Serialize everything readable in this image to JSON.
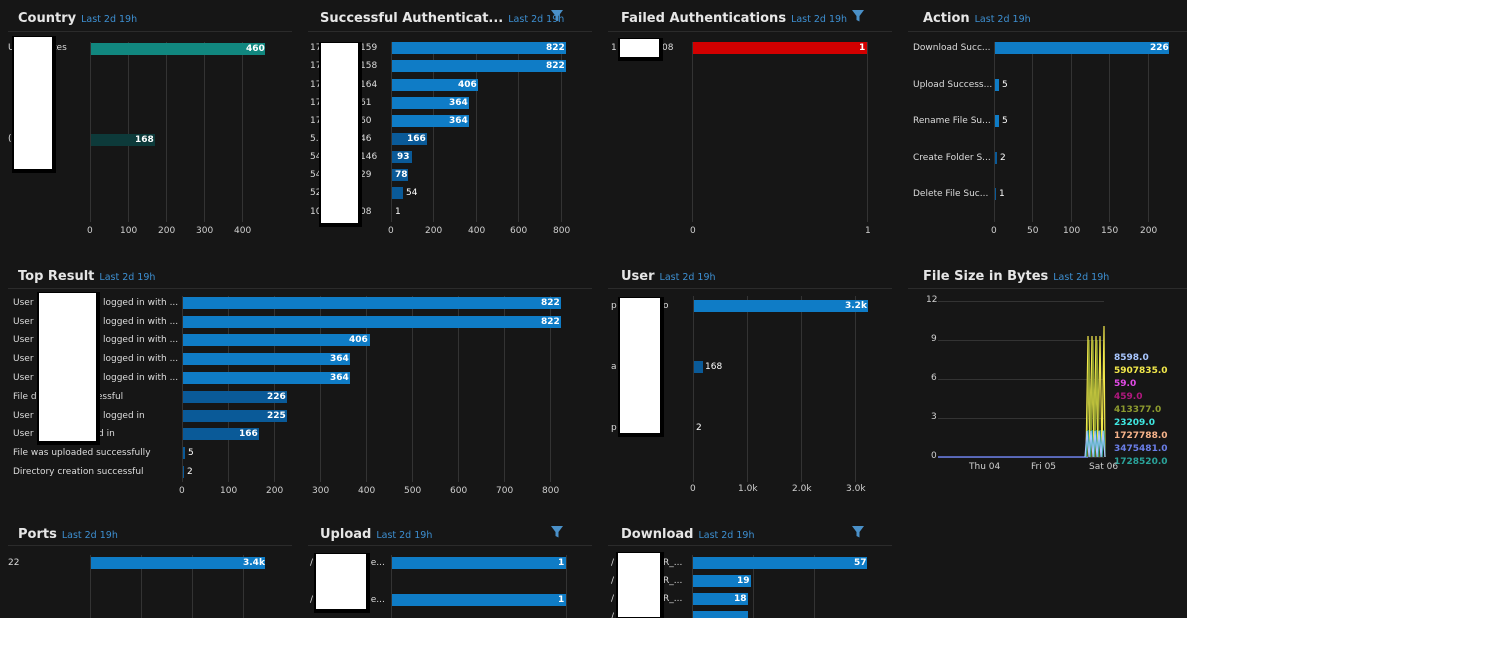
{
  "colors": {
    "bar_primary": "#0f7cc6",
    "bar_dark": "#0a5a98",
    "bar_teal": "#11877f",
    "bar_dark_teal": "#0d3a3a",
    "bar_red": "#d10000",
    "filter_icon": "#4a90c8"
  },
  "panels": {
    "country": {
      "title": "Country",
      "range": "Last 2d 19h",
      "labels": [
        "U",
        "tes",
        "("
      ],
      "values": [
        "460",
        "168"
      ],
      "ticks": [
        "0",
        "100",
        "200",
        "300",
        "400"
      ]
    },
    "success_auth": {
      "title": "Successful Authenticat...",
      "range": "Last 2d 19h",
      "filter_icon": "filter-icon",
      "label_prefix": [
        "17",
        "17",
        "17",
        "17",
        "17",
        "5.",
        "54",
        "54",
        "52",
        "10"
      ],
      "label_suffix": [
        "159",
        "158",
        "164",
        "61",
        "60",
        "46",
        "146",
        "29",
        "",
        "08"
      ],
      "values": [
        "822",
        "822",
        "406",
        "364",
        "364",
        "166",
        "93",
        "78",
        "54",
        "1"
      ],
      "ticks": [
        "0",
        "200",
        "400",
        "600",
        "800"
      ]
    },
    "failed_auth": {
      "title": "Failed Authentications",
      "range": "Last 2d 19h",
      "filter_icon": "filter-icon",
      "label_prefix": "1",
      "label_suffix": "08",
      "value": "1",
      "ticks": [
        "0",
        "1"
      ]
    },
    "action": {
      "title": "Action",
      "range": "Last 2d 19h",
      "labels": [
        "Download Succ...",
        "Upload Success...",
        "Rename File Su...",
        "Create Folder S...",
        "Delete File Suc..."
      ],
      "values": [
        "226",
        "5",
        "5",
        "2",
        "1"
      ],
      "ticks": [
        "0",
        "50",
        "100",
        "150",
        "200"
      ]
    },
    "top_result": {
      "title": "Top Result",
      "range": "Last 2d 19h",
      "label_left": [
        "User",
        "User",
        "User",
        "User",
        "User",
        "File d",
        "User",
        "User",
        "File was uploaded successfully",
        "Directory creation successful"
      ],
      "label_right": [
        "logged in with ...",
        "logged in with ...",
        "logged in with ...",
        "logged in with ...",
        "logged in with ...",
        "ccessful",
        "logged in",
        "d in",
        "",
        ""
      ],
      "values": [
        "822",
        "822",
        "406",
        "364",
        "364",
        "226",
        "225",
        "166",
        "5",
        "2"
      ],
      "ticks": [
        "0",
        "100",
        "200",
        "300",
        "400",
        "500",
        "600",
        "700",
        "800"
      ]
    },
    "user": {
      "title": "User",
      "range": "Last 2d 19h",
      "label_prefix": [
        "p",
        "a",
        "p"
      ],
      "label_suffix": [
        "o",
        "",
        ""
      ],
      "values": [
        "3.2k",
        "168",
        "2"
      ],
      "ticks": [
        "0",
        "1.0k",
        "2.0k",
        "3.0k"
      ]
    },
    "file_size": {
      "title": "File Size in Bytes",
      "range": "Last 2d 19h",
      "y_ticks": [
        "12",
        "9",
        "6",
        "3",
        "0"
      ],
      "x_ticks": [
        "Thu 04",
        "Fri 05",
        "Sat 06"
      ],
      "legend": [
        {
          "label": "8598.0",
          "color": "#a9c7ff"
        },
        {
          "label": "5907835.0",
          "color": "#f2e84b"
        },
        {
          "label": "59.0",
          "color": "#e14be6"
        },
        {
          "label": "459.0",
          "color": "#b0187e"
        },
        {
          "label": "413377.0",
          "color": "#8d9b2f"
        },
        {
          "label": "23209.0",
          "color": "#3fe7e1"
        },
        {
          "label": "1727788.0",
          "color": "#f6b38a"
        },
        {
          "label": "3475481.0",
          "color": "#6a7ee8"
        },
        {
          "label": "1728520.0",
          "color": "#2aa39a"
        }
      ]
    },
    "ports": {
      "title": "Ports",
      "range": "Last 2d 19h",
      "labels": [
        "22"
      ],
      "values": [
        "3.4k"
      ]
    },
    "upload": {
      "title": "Upload",
      "range": "Last 2d 19h",
      "filter_icon": "filter-icon",
      "label_prefix": [
        "/",
        "/"
      ],
      "label_suffix": [
        "ge...",
        "ge..."
      ],
      "values": [
        "1",
        "1"
      ]
    },
    "download": {
      "title": "Download",
      "range": "Last 2d 19h",
      "filter_icon": "filter-icon",
      "label_prefix": [
        "/",
        "/",
        "/",
        "/"
      ],
      "label_suffix": [
        "R_...",
        "R_...",
        "R_...",
        ""
      ],
      "values": [
        "57",
        "19",
        "18",
        ""
      ]
    }
  },
  "chart_data": [
    {
      "type": "bar",
      "title": "Country",
      "categories": [
        "U...tes",
        "("
      ],
      "values": [
        460,
        168
      ],
      "xlim": [
        0,
        460
      ]
    },
    {
      "type": "bar",
      "title": "Successful Authenticat...",
      "values": [
        822,
        822,
        406,
        364,
        364,
        166,
        93,
        78,
        54,
        1
      ],
      "xlim": [
        0,
        822
      ]
    },
    {
      "type": "bar",
      "title": "Failed Authentications",
      "values": [
        1
      ],
      "xlim": [
        0,
        1
      ]
    },
    {
      "type": "bar",
      "title": "Action",
      "categories": [
        "Download Succ...",
        "Upload Success...",
        "Rename File Su...",
        "Create Folder S...",
        "Delete File Suc..."
      ],
      "values": [
        226,
        5,
        5,
        2,
        1
      ],
      "xlim": [
        0,
        226
      ]
    },
    {
      "type": "bar",
      "title": "Top Result",
      "values": [
        822,
        822,
        406,
        364,
        364,
        226,
        225,
        166,
        5,
        2
      ],
      "xlim": [
        0,
        822
      ]
    },
    {
      "type": "bar",
      "title": "User",
      "values": [
        3200,
        168,
        2
      ],
      "xlim": [
        0,
        3200
      ]
    },
    {
      "type": "line",
      "title": "File Size in Bytes",
      "x_ticks": [
        "Thu 04",
        "Fri 05",
        "Sat 06"
      ],
      "ylim": [
        0,
        12
      ],
      "series_names": [
        "8598.0",
        "5907835.0",
        "59.0",
        "459.0",
        "413377.0",
        "23209.0",
        "1727788.0",
        "3475481.0",
        "1728520.0"
      ]
    },
    {
      "type": "bar",
      "title": "Ports",
      "categories": [
        "22"
      ],
      "values": [
        3400
      ]
    },
    {
      "type": "bar",
      "title": "Upload",
      "values": [
        1,
        1
      ],
      "xlim": [
        0,
        1
      ]
    },
    {
      "type": "bar",
      "title": "Download",
      "values": [
        57,
        19,
        18
      ],
      "xlim": [
        0,
        57
      ]
    }
  ]
}
